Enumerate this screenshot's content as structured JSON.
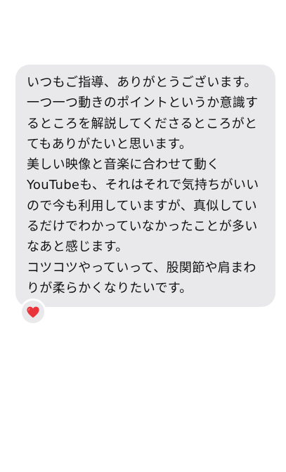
{
  "message": {
    "paragraphs": [
      "いつもご指導、ありがとうございます。",
      "一つ一つ動きのポイントというか意識するところを解説してくださるところがとてもありがたいと思います。",
      "美しい映像と音楽に合わせて動くYouTubeも、それはそれで気持ちがいいので今も利用していますが、真似しているだけでわかっていなかったことが多いなあと感じます。",
      "コツコツやっていって、股関節や肩まわりが柔らかくなりたいです。"
    ]
  },
  "reaction": {
    "icon": "heart-icon",
    "color": "#e8343a"
  },
  "colors": {
    "bubble": "#e9e9eb",
    "text": "#111111",
    "background": "#ffffff"
  }
}
